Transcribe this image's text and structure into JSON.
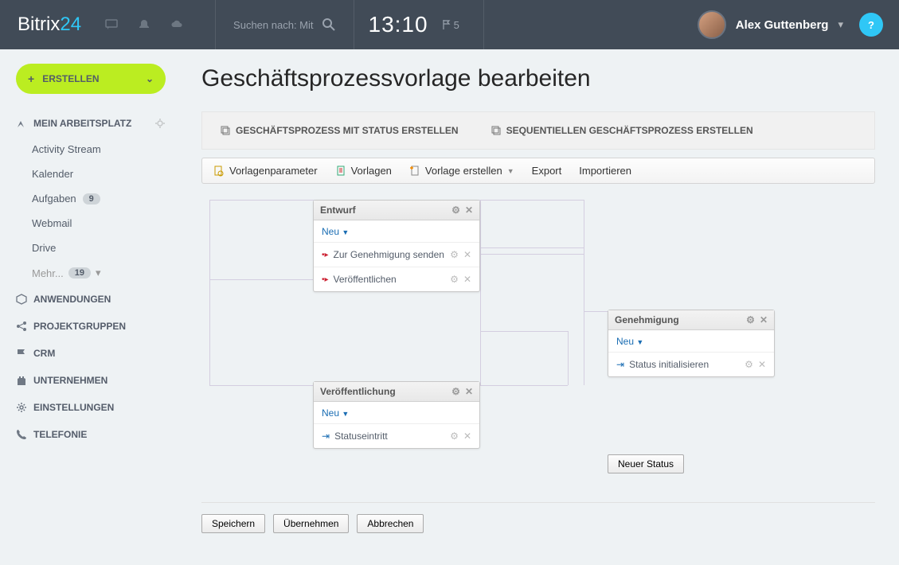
{
  "header": {
    "logo1": "Bitrix",
    "logo2": "24",
    "search_label": "Suchen nach: Mit",
    "clock": "13:10",
    "flag_count": "5",
    "user_name": "Alex Guttenberg",
    "help": "?"
  },
  "sidebar": {
    "create": "ERSTELLEN",
    "sections": {
      "workspace": "MEIN ARBEITSPLATZ",
      "apps": "ANWENDUNGEN",
      "groups": "PROJEKTGRUPPEN",
      "crm": "CRM",
      "company": "UNTERNEHMEN",
      "settings": "EINSTELLUNGEN",
      "telephony": "TELEFONIE"
    },
    "workspace_items": {
      "activity": "Activity Stream",
      "calendar": "Kalender",
      "tasks": "Aufgaben",
      "tasks_badge": "9",
      "webmail": "Webmail",
      "drive": "Drive",
      "more": "Mehr...",
      "more_badge": "19"
    }
  },
  "page": {
    "title": "Geschäftsprozessvorlage bearbeiten",
    "tab1": "GESCHÄFTSPROZESS MIT STATUS ERSTELLEN",
    "tab2": "SEQUENTIELLEN GESCHÄFTSPROZESS ERSTELLEN",
    "toolbar": {
      "params": "Vorlagenparameter",
      "templates": "Vorlagen",
      "create": "Vorlage erstellen",
      "export": "Export",
      "import": "Importieren"
    }
  },
  "canvas": {
    "box1": {
      "title": "Entwurf",
      "new": "Neu",
      "r1": "Zur Genehmigung senden",
      "r2": "Veröffentlichen"
    },
    "box2": {
      "title": "Genehmigung",
      "new": "Neu",
      "r1": "Status initialisieren"
    },
    "box3": {
      "title": "Veröffentlichung",
      "new": "Neu",
      "r1": "Statuseintritt"
    },
    "newstatus": "Neuer Status"
  },
  "actions": {
    "save": "Speichern",
    "apply": "Übernehmen",
    "cancel": "Abbrechen"
  }
}
